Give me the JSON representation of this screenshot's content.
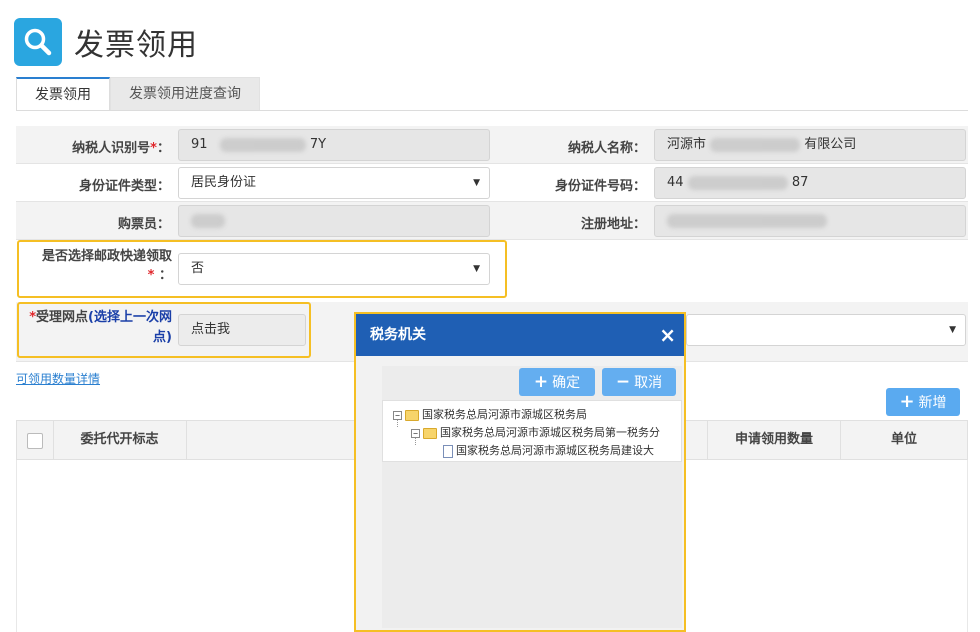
{
  "header": {
    "title": "发票领用",
    "icon": "search-icon",
    "accent": "#2aa6e0"
  },
  "tabs": [
    {
      "label": "发票领用",
      "active": true
    },
    {
      "label": "发票领用进度查询",
      "active": false
    }
  ],
  "form": {
    "taxpayer_id": {
      "label": "纳税人识别号",
      "required_mark": "*",
      "colon": "：",
      "prefix": "91",
      "suffix": "7Y"
    },
    "taxpayer_name": {
      "label": "纳税人名称",
      "colon": "：",
      "prefix": "河源市",
      "suffix": "有限公司"
    },
    "id_type": {
      "label": "身份证件类型",
      "colon": "：",
      "value": "居民身份证"
    },
    "id_number": {
      "label": "身份证件号码",
      "colon": "：",
      "prefix": "44",
      "suffix": "87"
    },
    "buyer": {
      "label": "购票员",
      "colon": "："
    },
    "address": {
      "label": "注册地址",
      "colon": "："
    },
    "post_delivery": {
      "label": "是否选择邮政快递领取",
      "required_mark": "*",
      "colon": "：",
      "value": "否"
    },
    "service_point": {
      "required_mark": "*",
      "label": "受理网点",
      "hint": "(选择上一次网点)",
      "value": "点击我"
    }
  },
  "links": {
    "quantity_detail": "可领用数量详情"
  },
  "toolbar": {
    "add_label": "新增",
    "add_icon": "plus-icon"
  },
  "table": {
    "columns": [
      "委托代开标志",
      "申请领用数量",
      "单位"
    ]
  },
  "modal": {
    "title": "税务机关",
    "confirm_label": "确定",
    "cancel_label": "取消",
    "tree": [
      {
        "label": "国家税务总局河源市源城区税务局",
        "level": 0,
        "type": "folder"
      },
      {
        "label": "国家税务总局河源市源城区税务局第一税务分",
        "level": 1,
        "type": "folder"
      },
      {
        "label": "国家税务总局河源市源城区税务局建设大",
        "level": 2,
        "type": "document"
      }
    ]
  },
  "colors": {
    "modal_header": "#1f5fb4",
    "highlight": "#f5bf24",
    "button": "#5aaaf0",
    "required": "#e0262b",
    "hint": "#1a3fa8"
  }
}
